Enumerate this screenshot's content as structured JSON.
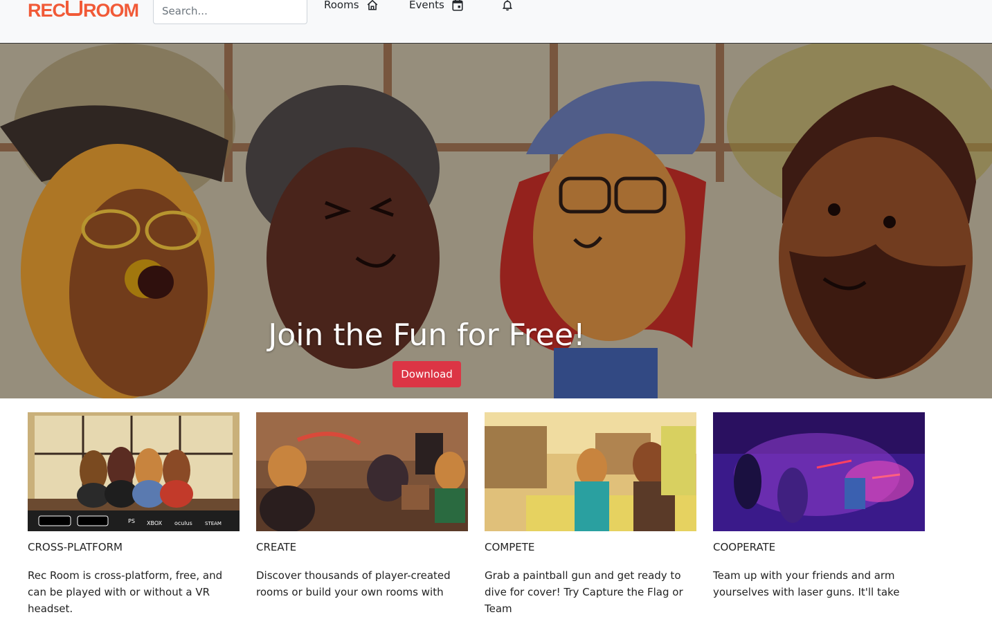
{
  "brand": {
    "name_left": "REC",
    "name_right": "ROOM",
    "color": "#f15a37"
  },
  "search": {
    "placeholder": "Search..."
  },
  "nav": [
    {
      "label": "Rooms",
      "icon": "house-icon"
    },
    {
      "label": "Events",
      "icon": "calendar-icon"
    },
    {
      "label": "",
      "icon": "bell-icon"
    }
  ],
  "hero": {
    "title": "Join the Fun for Free!",
    "button_label": "Download",
    "button_color": "#dc3545"
  },
  "features": [
    {
      "title": "CROSS-PLATFORM",
      "text": "Rec Room is cross-platform, free, and can be played with or without a VR headset.",
      "platform_badges": [
        "GET IT ON Google Play",
        "Download on the App Store",
        "PlayStation",
        "XBOX",
        "oculus",
        "STEAM"
      ]
    },
    {
      "title": "CREATE",
      "text": "Discover thousands of player-created rooms or build your own rooms with"
    },
    {
      "title": "COMPETE",
      "text": "Grab a paintball gun and get ready to dive for cover! Try Capture the Flag or Team"
    },
    {
      "title": "COOPERATE",
      "text": "Team up with your friends and arm yourselves with laser guns. It'll take"
    }
  ]
}
